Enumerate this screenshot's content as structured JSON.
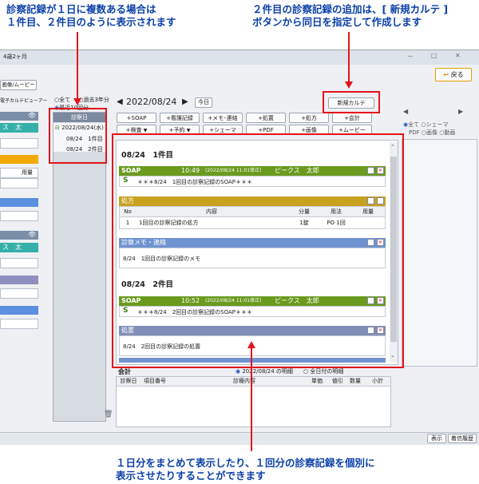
{
  "annotations": {
    "top_left_line1": "診察記録が１日に複数ある場合は",
    "top_left_line2": "１件目、２件目のように表示されます",
    "top_right_line1": "２件目の診察記録の追加は、[ 新規カルテ ]",
    "top_right_line2": "ボタンから同日を指定して作成します",
    "bottom_line1": "１日分をまとめて表示したり、１回分の診察記録を個別に",
    "bottom_line2": "表示させたりすることができます"
  },
  "window": {
    "age_tab": "4歳2ヶ月",
    "media_tab": "画像/ムービー",
    "viewer_label": "電子カルテビューアー",
    "back_button": "戻る",
    "min_glyph": "－",
    "max_glyph": "□",
    "close_glyph": "✕"
  },
  "left_panel": {
    "patient1_name": "ス　太",
    "patient2_name": "ス　太",
    "col_header": "用量"
  },
  "date_list": {
    "filter_all": "全て",
    "filter_past3": "過去3年分",
    "filter_recent": "最近10回分",
    "header": "診察日",
    "date_entry": "2022/08/24(水)",
    "item1": "08/24　1件目",
    "item2": "08/24　2件目"
  },
  "toolbar": {
    "date": "2022/08/24",
    "prev_glyph": "◀",
    "next_glyph": "▶",
    "today": "今日",
    "new_karte": "新規カルテ",
    "row1": [
      "+SOAP",
      "+看護記録",
      "+メモ･連絡",
      "+処置",
      "+処方",
      "+会計"
    ],
    "row2": [
      "+検査",
      "+予約",
      "+シェーマ",
      "+PDF",
      "+画像",
      "+ムービー"
    ]
  },
  "right_side": {
    "prev_glyph": "◀",
    "next_glyph": "▶",
    "opt_all": "全て",
    "opt_schema": "シェーマ",
    "opt_pdf": "PDF",
    "opt_image": "画像",
    "opt_video": "動画"
  },
  "record1": {
    "heading": "08/24　1件目",
    "soap_label": "SOAP",
    "soap_time": "10:49",
    "soap_stamp": "(2022/08/24 11:01修正)",
    "soap_user": "ピークス　太郎",
    "soap_letter": "S",
    "soap_text": "＊＊＊8/24　1回目の診察記録のSOAP＊＊＊",
    "rx_label": "処方",
    "rx_headers": [
      "No",
      "内容",
      "分量",
      "用法",
      "用量"
    ],
    "rx_row": [
      "1",
      "1回目の診察記録の処方",
      "1錠",
      "PO 1回",
      ""
    ],
    "memo_label": "診察メモ・連絡",
    "memo_text": "8/24　1回目の診察記録のメモ"
  },
  "record2": {
    "heading": "08/24　2件目",
    "soap_label": "SOAP",
    "soap_time": "10:52",
    "soap_stamp": "(2022/08/24 11:01修正)",
    "soap_user": "ピークス　太郎",
    "soap_letter": "S",
    "soap_text": "＊＊＊8/24　2回目の診察記録のSOAP＊＊＊",
    "proc_label": "処置",
    "proc_text": "8/24　2回目の診察記録の処置"
  },
  "billing": {
    "title": "会計",
    "opt_date": "2022/08/24 の明細",
    "opt_all": "全日付の明細",
    "headers": [
      "診察日",
      "項目番号",
      "診療内容",
      "単価",
      "値引",
      "数量",
      "小計"
    ]
  },
  "footer": {
    "display": "表示",
    "history": "着信履歴"
  },
  "colors": {
    "annotation_text": "#0b3fa8",
    "highlight": "#e3141b",
    "soap_bar": "#6a9a1e",
    "rx_bar": "#c8a11e",
    "memo_bar": "#6f93d1",
    "proc_bar": "#7f8fb7"
  }
}
